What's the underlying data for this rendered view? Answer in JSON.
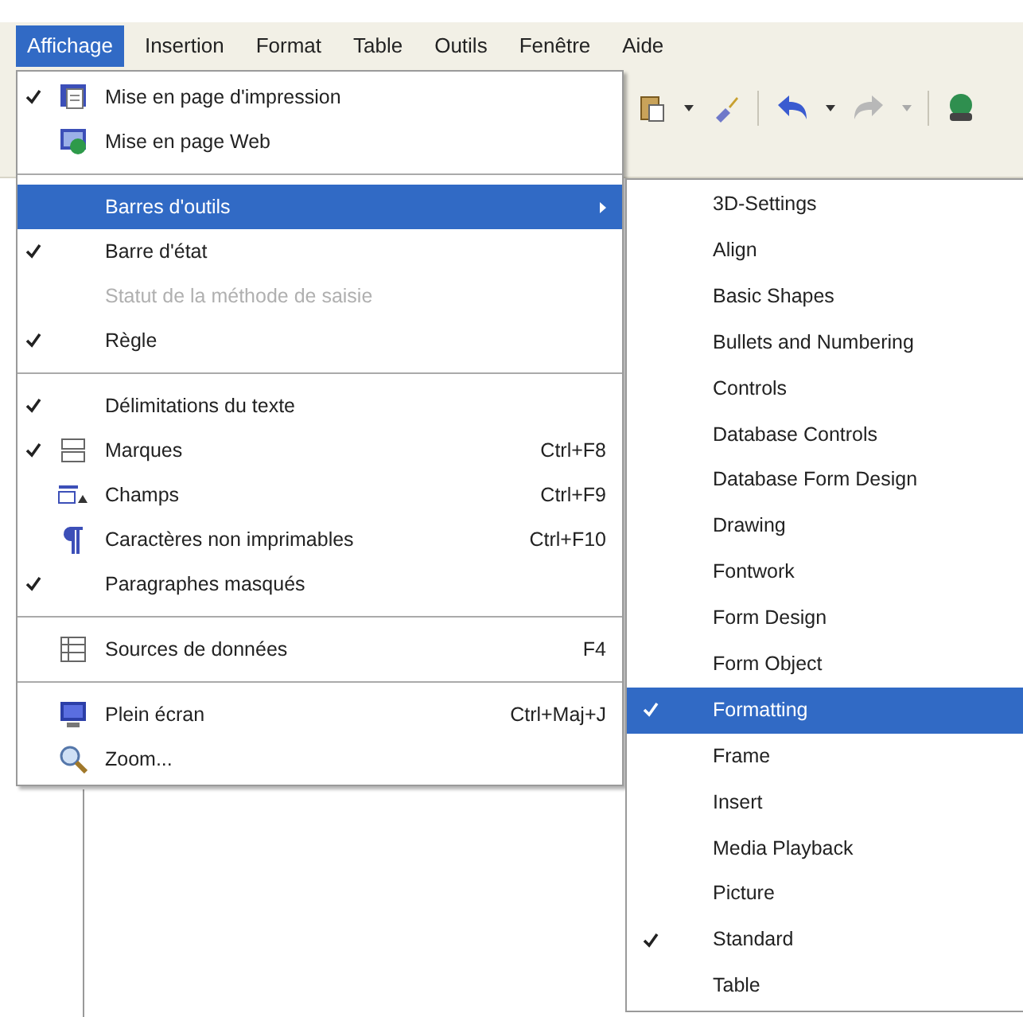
{
  "menubar": [
    {
      "label": "Affichage",
      "selected": true
    },
    {
      "label": "Insertion",
      "selected": false
    },
    {
      "label": "Format",
      "selected": false
    },
    {
      "label": "Table",
      "selected": false
    },
    {
      "label": "Outils",
      "selected": false
    },
    {
      "label": "Fenêtre",
      "selected": false
    },
    {
      "label": "Aide",
      "selected": false
    }
  ],
  "view_menu": {
    "items": [
      {
        "kind": "item",
        "label": "Mise en page d'impression",
        "checked": true,
        "disabled": false,
        "selected": false,
        "submenu": false
      },
      {
        "kind": "item",
        "label": "Mise en page Web",
        "checked": false,
        "disabled": false,
        "selected": false,
        "submenu": false
      },
      {
        "kind": "separator"
      },
      {
        "kind": "item",
        "label": "Barres d'outils",
        "checked": false,
        "disabled": false,
        "selected": true,
        "submenu": true
      },
      {
        "kind": "item",
        "label": "Barre d'état",
        "checked": true,
        "disabled": false,
        "selected": false,
        "submenu": false
      },
      {
        "kind": "item",
        "label": "Statut de la méthode de saisie",
        "checked": false,
        "disabled": true,
        "selected": false,
        "submenu": false
      },
      {
        "kind": "item",
        "label": "Règle",
        "checked": true,
        "disabled": false,
        "selected": false,
        "submenu": false
      },
      {
        "kind": "separator"
      },
      {
        "kind": "item",
        "label": "Délimitations du texte",
        "checked": true,
        "disabled": false,
        "selected": false,
        "submenu": false
      },
      {
        "kind": "item",
        "label": "Marques",
        "shortcut": "Ctrl+F8",
        "checked": true,
        "disabled": false,
        "selected": false,
        "submenu": false
      },
      {
        "kind": "item",
        "label": "Champs",
        "shortcut": "Ctrl+F9",
        "checked": false,
        "disabled": false,
        "selected": false,
        "submenu": false
      },
      {
        "kind": "item",
        "label": "Caractères non imprimables",
        "shortcut": "Ctrl+F10",
        "checked": false,
        "disabled": false,
        "selected": false,
        "submenu": false
      },
      {
        "kind": "item",
        "label": "Paragraphes masqués",
        "checked": true,
        "disabled": false,
        "selected": false,
        "submenu": false
      },
      {
        "kind": "separator"
      },
      {
        "kind": "item",
        "label": "Sources de données",
        "shortcut": "F4",
        "checked": false,
        "disabled": false,
        "selected": false,
        "submenu": false
      },
      {
        "kind": "separator"
      },
      {
        "kind": "item",
        "label": "Plein écran",
        "shortcut": "Ctrl+Maj+J",
        "checked": false,
        "disabled": false,
        "selected": false,
        "submenu": false
      },
      {
        "kind": "item",
        "label": "Zoom...",
        "checked": false,
        "disabled": false,
        "selected": false,
        "submenu": false
      }
    ]
  },
  "toolbars_submenu": {
    "items": [
      {
        "label": "3D-Settings",
        "checked": false,
        "selected": false
      },
      {
        "label": "Align",
        "checked": false,
        "selected": false
      },
      {
        "label": "Basic Shapes",
        "checked": false,
        "selected": false
      },
      {
        "label": "Bullets and Numbering",
        "checked": false,
        "selected": false
      },
      {
        "label": "Controls",
        "checked": false,
        "selected": false
      },
      {
        "label": "Database Controls",
        "checked": false,
        "selected": false
      },
      {
        "label": "Database Form Design",
        "checked": false,
        "selected": false
      },
      {
        "label": "Drawing",
        "checked": false,
        "selected": false
      },
      {
        "label": "Fontwork",
        "checked": false,
        "selected": false
      },
      {
        "label": "Form Design",
        "checked": false,
        "selected": false
      },
      {
        "label": "Form Object",
        "checked": false,
        "selected": false
      },
      {
        "label": "Formatting",
        "checked": true,
        "selected": true
      },
      {
        "label": "Frame",
        "checked": false,
        "selected": false
      },
      {
        "label": "Insert",
        "checked": false,
        "selected": false
      },
      {
        "label": "Media Playback",
        "checked": false,
        "selected": false
      },
      {
        "label": "Picture",
        "checked": false,
        "selected": false
      },
      {
        "label": "Standard",
        "checked": true,
        "selected": false
      },
      {
        "label": "Table",
        "checked": false,
        "selected": false
      }
    ]
  }
}
